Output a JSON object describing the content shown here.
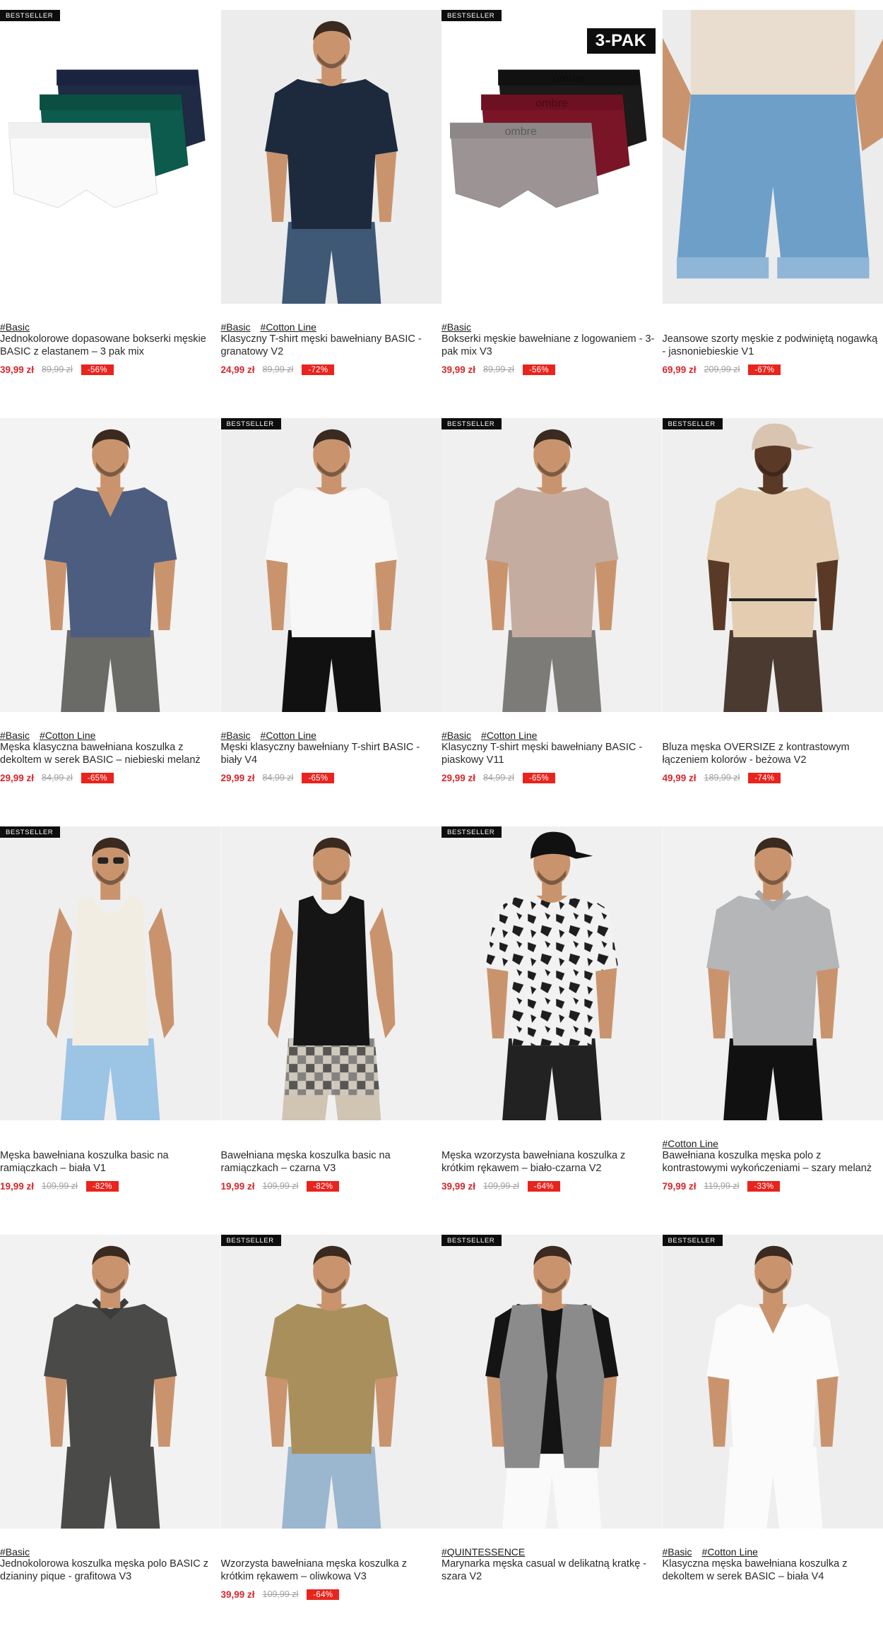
{
  "badge_label": "BESTSELLER",
  "pack_label": "3-PAK",
  "products": [
    {
      "bestseller": true,
      "pack": false,
      "tags": [
        "#Basic"
      ],
      "title": "Jednokolorowe dopasowane bokserki męskie BASIC z elastanem – 3 pak mix",
      "price": "39,99 zł",
      "old_price": "89,99 zł",
      "discount": "-56%",
      "image": "boxers-3pack-navy-green-white"
    },
    {
      "bestseller": false,
      "pack": false,
      "tags": [
        "#Basic",
        "#Cotton Line"
      ],
      "title": "Klasyczny T-shirt męski bawełniany BASIC - granatowy V2",
      "price": "24,99 zł",
      "old_price": "89,99 zł",
      "discount": "-72%",
      "image": "man-navy-tshirt"
    },
    {
      "bestseller": true,
      "pack": true,
      "tags": [
        "#Basic"
      ],
      "title": "Bokserki męskie bawełniane z logowaniem - 3-pak mix V3",
      "price": "39,99 zł",
      "old_price": "89,99 zł",
      "discount": "-56%",
      "image": "boxers-3pack-black-red-grey"
    },
    {
      "bestseller": false,
      "pack": false,
      "tags": [],
      "title": "Jeansowe szorty męskie z podwiniętą nogawką - jasnoniebieskie V1",
      "price": "69,99 zł",
      "old_price": "209,99 zł",
      "discount": "-67%",
      "image": "denim-shorts-light-blue"
    },
    {
      "bestseller": false,
      "pack": false,
      "tags": [
        "#Basic",
        "#Cotton Line"
      ],
      "title": "Męska klasyczna bawełniana koszulka z dekoltem w serek BASIC – niebieski melanż",
      "price": "29,99 zł",
      "old_price": "84,99 zł",
      "discount": "-65%",
      "image": "man-blue-vneck"
    },
    {
      "bestseller": true,
      "pack": false,
      "tags": [
        "#Basic",
        "#Cotton Line"
      ],
      "title": "Męski klasyczny bawełniany T-shirt BASIC - biały V4",
      "price": "29,99 zł",
      "old_price": "84,99 zł",
      "discount": "-65%",
      "image": "man-white-tshirt"
    },
    {
      "bestseller": true,
      "pack": false,
      "tags": [
        "#Basic",
        "#Cotton Line"
      ],
      "title": "Klasyczny T-shirt męski bawełniany BASIC - piaskowy V11",
      "price": "29,99 zł",
      "old_price": "84,99 zł",
      "discount": "-65%",
      "image": "man-sand-tshirt"
    },
    {
      "bestseller": true,
      "pack": false,
      "tags": [],
      "title": "Bluza męska OVERSIZE z kontrastowym łączeniem kolorów - beżowa V2",
      "price": "49,99 zł",
      "old_price": "189,99 zł",
      "discount": "-74%",
      "image": "man-beige-sweatshirt"
    },
    {
      "bestseller": true,
      "pack": false,
      "tags": [],
      "title": "Męska bawełniana koszulka basic na ramiączkach – biała V1",
      "price": "19,99 zł",
      "old_price": "109,99 zł",
      "discount": "-82%",
      "image": "man-white-tank"
    },
    {
      "bestseller": false,
      "pack": false,
      "tags": [],
      "title": "Bawełniana męska koszulka basic na ramiączkach – czarna V3",
      "price": "19,99 zł",
      "old_price": "109,99 zł",
      "discount": "-82%",
      "image": "man-black-tank"
    },
    {
      "bestseller": true,
      "pack": false,
      "tags": [],
      "title": "Męska wzorzysta bawełniana koszulka z krótkim rękawem – biało-czarna V2",
      "price": "39,99 zł",
      "old_price": "109,99 zł",
      "discount": "-64%",
      "image": "man-pattern-tshirt"
    },
    {
      "bestseller": false,
      "pack": false,
      "tags": [
        "#Cotton Line"
      ],
      "title": "Bawełniana koszulka męska polo z kontrastowymi wykończeniami – szary melanż",
      "price": "79,99 zł",
      "old_price": "119,99 zł",
      "discount": "-33%",
      "image": "man-grey-polo"
    },
    {
      "bestseller": false,
      "pack": false,
      "tags": [
        "#Basic"
      ],
      "title": "Jednokolorowa koszulka męska polo BASIC z dzianiny pique - grafitowa V3",
      "price": "",
      "old_price": "",
      "discount": "",
      "image": "man-graphite-polo"
    },
    {
      "bestseller": true,
      "pack": false,
      "tags": [],
      "title": "Wzorzysta bawełniana męska koszulka z krótkim rękawem – oliwkowa V3",
      "price": "39,99 zł",
      "old_price": "109,99 zł",
      "discount": "-64%",
      "image": "man-olive-tshirt"
    },
    {
      "bestseller": true,
      "pack": false,
      "tags": [
        "#QUINTESSENCE"
      ],
      "title": "Marynarka męska casual w delikatną kratkę - szara V2",
      "price": "",
      "old_price": "",
      "discount": "",
      "image": "man-grey-blazer"
    },
    {
      "bestseller": true,
      "pack": false,
      "tags": [
        "#Basic",
        "#Cotton Line"
      ],
      "title": "Klasyczna męska bawełniana koszulka z dekoltem w serek BASIC – biała V4",
      "price": "",
      "old_price": "",
      "discount": "",
      "image": "man-white-vneck"
    }
  ]
}
